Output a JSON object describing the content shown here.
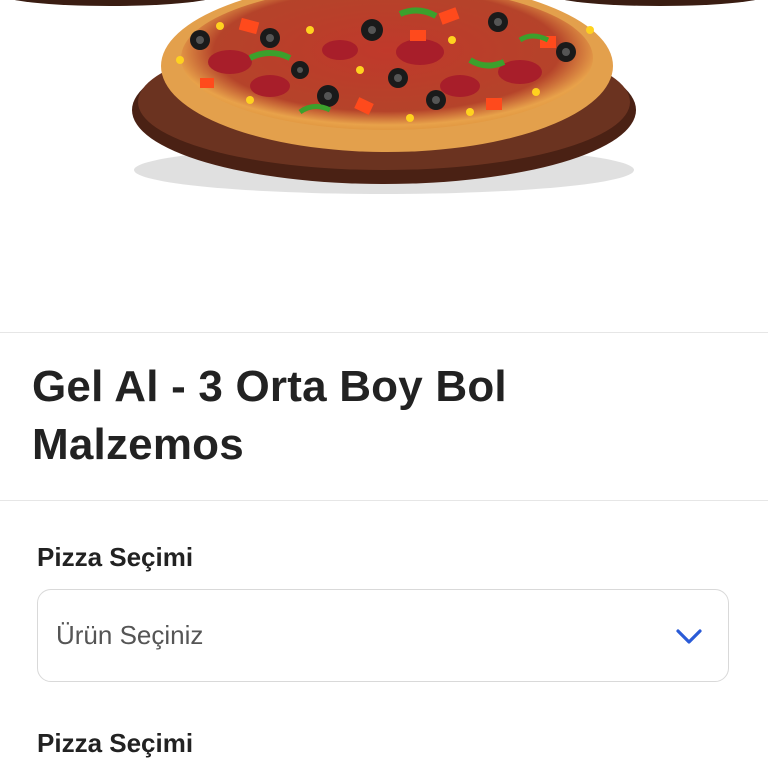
{
  "product": {
    "image_alt": "pizza",
    "title_line1": "Gel Al - 3 Orta Boy Bol",
    "title_line2": "Malzemos"
  },
  "selections": [
    {
      "label": "Pizza Seçimi",
      "placeholder": "Ürün Seçiniz",
      "icon": "chevron-down-icon"
    },
    {
      "label": "Pizza Seçimi"
    }
  ],
  "colors": {
    "accent": "#2a5bd7",
    "border": "#d9d9d9",
    "divider": "#e6e6e6",
    "text": "#222222",
    "placeholder": "#555555"
  }
}
